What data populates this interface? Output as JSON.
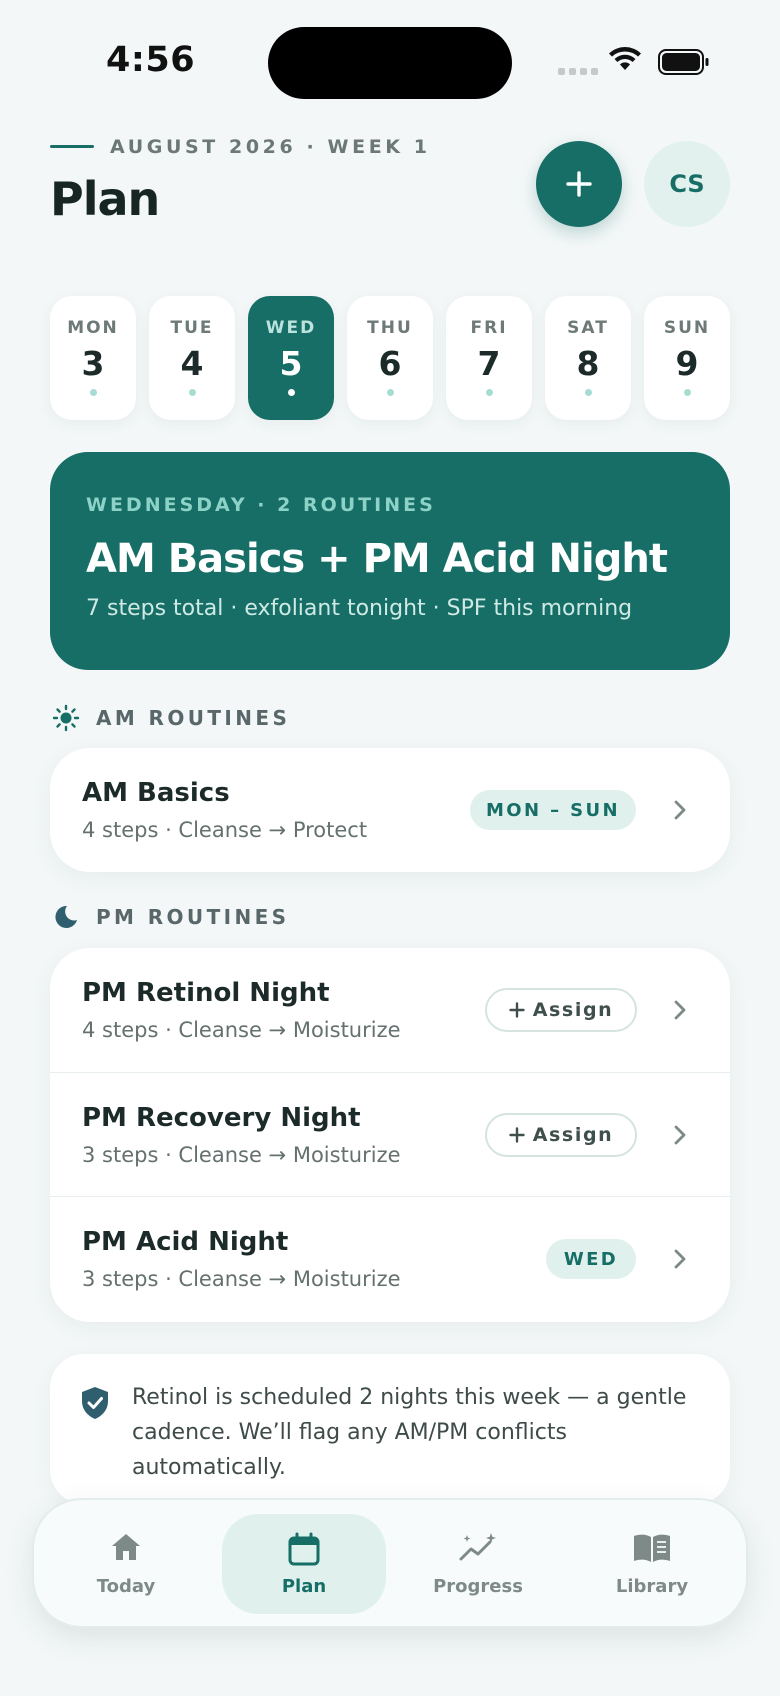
{
  "status_bar": {
    "time": "4:56"
  },
  "header": {
    "eyebrow": "AUGUST 2026 · WEEK 1",
    "title": "Plan",
    "add_label": "+",
    "avatar_initials": "CS"
  },
  "week": {
    "days": [
      {
        "name": "MON",
        "num": "3",
        "active": false
      },
      {
        "name": "TUE",
        "num": "4",
        "active": false
      },
      {
        "name": "WED",
        "num": "5",
        "active": true
      },
      {
        "name": "THU",
        "num": "6",
        "active": false
      },
      {
        "name": "FRI",
        "num": "7",
        "active": false
      },
      {
        "name": "SAT",
        "num": "8",
        "active": false
      },
      {
        "name": "SUN",
        "num": "9",
        "active": false
      }
    ]
  },
  "hero": {
    "eyebrow": "WEDNESDAY · 2 ROUTINES",
    "title": "AM Basics + PM Acid Night",
    "subtitle": "7 steps total · exfoliant tonight · SPF this morning"
  },
  "am": {
    "label": "AM ROUTINES",
    "routines": [
      {
        "title": "AM Basics",
        "sub": "4 steps · Cleanse → Protect",
        "badge": "MON – SUN"
      }
    ]
  },
  "pm": {
    "label": "PM ROUTINES",
    "routines": [
      {
        "title": "PM Retinol Night",
        "sub": "4 steps · Cleanse → Moisturize",
        "action": "Assign"
      },
      {
        "title": "PM Recovery Night",
        "sub": "3 steps · Cleanse → Moisturize",
        "action": "Assign"
      },
      {
        "title": "PM Acid Night",
        "sub": "3 steps · Cleanse → Moisturize",
        "badge": "WED"
      }
    ]
  },
  "note": {
    "text": "Retinol is scheduled 2 nights this week — a gentle cadence. We’ll flag any AM/PM conflicts automatically."
  },
  "tabbar": {
    "tabs": [
      {
        "label": "Today",
        "icon": "home-icon",
        "active": false
      },
      {
        "label": "Plan",
        "icon": "calendar-icon",
        "active": true
      },
      {
        "label": "Progress",
        "icon": "progress-sparkle-icon",
        "active": false
      },
      {
        "label": "Library",
        "icon": "book-icon",
        "active": false
      }
    ]
  },
  "colors": {
    "accent": "#166e66",
    "accent_soft": "#e0f1ed",
    "background": "#f3f7f7"
  }
}
